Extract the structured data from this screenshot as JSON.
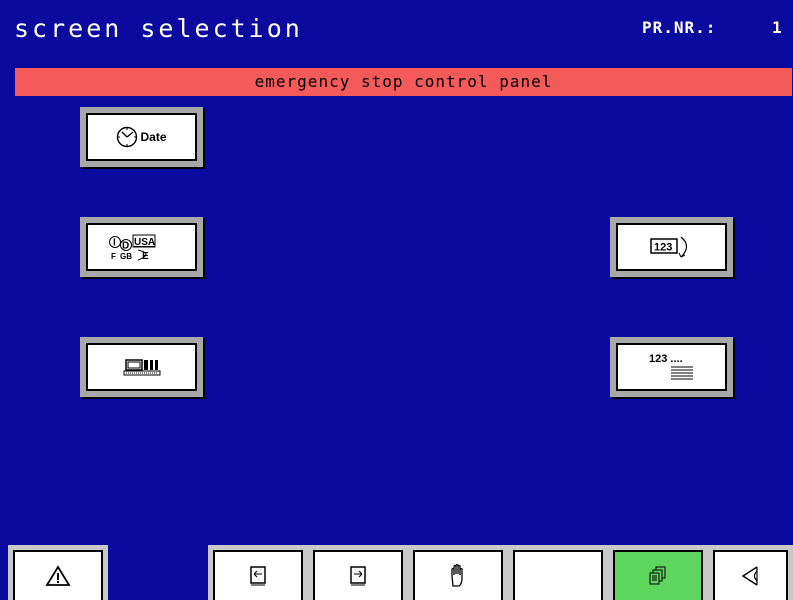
{
  "header": {
    "title": "screen selection",
    "prnr_label": "PR.NR.:",
    "prnr_value": "1"
  },
  "banner": {
    "text": "emergency stop control panel"
  },
  "buttons": {
    "date_label": "Date",
    "language_codes": [
      "I",
      "D",
      "USA",
      "F",
      "GB",
      "E"
    ],
    "counter_label": "123",
    "numbering_label": "123 ...."
  },
  "toolbar": {
    "items": [
      {
        "icon": "warning-icon"
      },
      {
        "icon": "machine-cycle-left-icon"
      },
      {
        "icon": "machine-cycle-right-icon"
      },
      {
        "icon": "hand-stop-icon"
      },
      {
        "icon": "empty"
      },
      {
        "icon": "screen-pages-icon",
        "active": true
      },
      {
        "icon": "back-arrow-icon"
      }
    ]
  },
  "colors": {
    "background": "#0a0a9e",
    "banner": "#f55a5a",
    "active_tool": "#5ed65e"
  }
}
